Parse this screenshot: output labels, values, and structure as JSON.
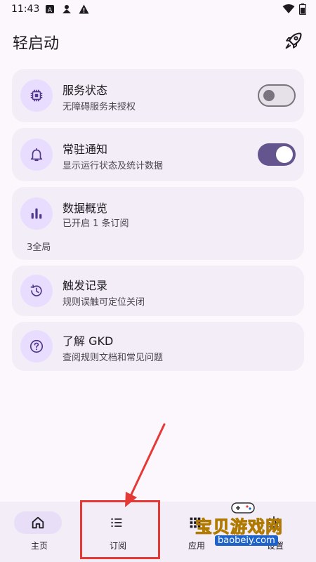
{
  "status_bar": {
    "time": "11:43",
    "left_icons": [
      "a-letter-icon",
      "person-icon",
      "warning-icon"
    ],
    "right_icons": [
      "wifi-icon",
      "battery-icon"
    ]
  },
  "header": {
    "title": "轻启动",
    "action_icon": "rocket-icon"
  },
  "cards": [
    {
      "icon": "chip-icon",
      "title": "服务状态",
      "subtitle": "无障碍服务未授权",
      "toggle": false
    },
    {
      "icon": "bell-icon",
      "title": "常驻通知",
      "subtitle": "显示运行状态及统计数据",
      "toggle": true
    },
    {
      "icon": "bar-chart-icon",
      "title": "数据概览",
      "subtitle": "已开启 1 条订阅",
      "extra": "3全局"
    },
    {
      "icon": "history-icon",
      "title": "触发记录",
      "subtitle": "规则误触可定位关闭"
    },
    {
      "icon": "help-icon",
      "title": "了解 GKD",
      "subtitle": "查阅规则文档和常见问题"
    }
  ],
  "bottom_nav": [
    {
      "label": "主页",
      "icon": "home-icon",
      "active": true
    },
    {
      "label": "订阅",
      "icon": "list-icon",
      "active": false
    },
    {
      "label": "应用",
      "icon": "apps-icon",
      "active": false
    },
    {
      "label": "设置",
      "icon": "settings-icon",
      "active": false
    }
  ],
  "watermark": {
    "text": "宝贝游戏网",
    "url": "baobeiy.com"
  },
  "colors": {
    "background": "#FBF7FC",
    "card": "#F3EDF7",
    "icon_circle": "#E9DDFF",
    "accent": "#65558F",
    "annotation": "#E53935"
  }
}
